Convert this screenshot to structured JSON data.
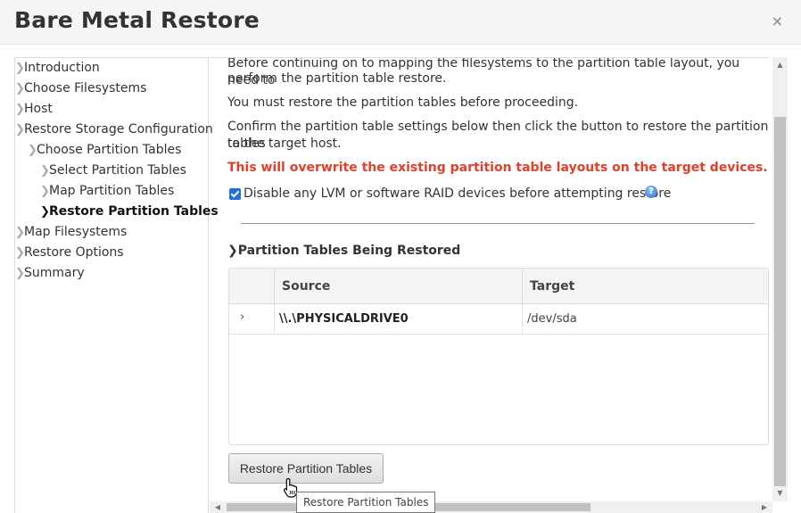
{
  "dialog": {
    "title": "Bare Metal Restore",
    "close_label": "×"
  },
  "sidebar": {
    "items": [
      {
        "label": "Introduction",
        "active": false
      },
      {
        "label": "Choose Filesystems",
        "active": false
      },
      {
        "label": "Host",
        "active": false
      },
      {
        "label": "Restore Storage Configuration",
        "active": false
      },
      {
        "label": "Choose Partition Tables",
        "active": false
      },
      {
        "label": "Select Partition Tables",
        "active": false
      },
      {
        "label": "Map Partition Tables",
        "active": false
      },
      {
        "label": "Restore Partition Tables",
        "active": true
      },
      {
        "label": "Map Filesystems",
        "active": false
      },
      {
        "label": "Restore Options",
        "active": false
      },
      {
        "label": "Summary",
        "active": false
      }
    ]
  },
  "content": {
    "intro_line1": "Before continuing on to mapping the filesystems to the partition table layout, you need to",
    "intro_line2": "perform the partition table restore.",
    "must_restore": "You must restore the partition tables before proceeding.",
    "confirm_line1": "Confirm the partition table settings below then click the button to restore the partition tables",
    "confirm_line2": "to the target host.",
    "warning": "This will overwrite the existing partition table layouts on the target devices.",
    "disable_checkbox": {
      "label": "Disable any LVM or software RAID devices before attempting restore",
      "checked": true
    },
    "help_icon": "question-icon",
    "section_title": "Partition Tables Being Restored",
    "table": {
      "columns": [
        "Source",
        "Target"
      ],
      "rows": [
        {
          "source": "\\\\.\\PHYSICALDRIVE0",
          "target": "/dev/sda"
        }
      ]
    },
    "restore_button": "Restore Partition Tables"
  },
  "tooltip": "Restore Partition Tables",
  "colors": {
    "warning": "#e1412c",
    "checkbox": "#1f6fe0",
    "header_bg": "#f5f5f5"
  }
}
